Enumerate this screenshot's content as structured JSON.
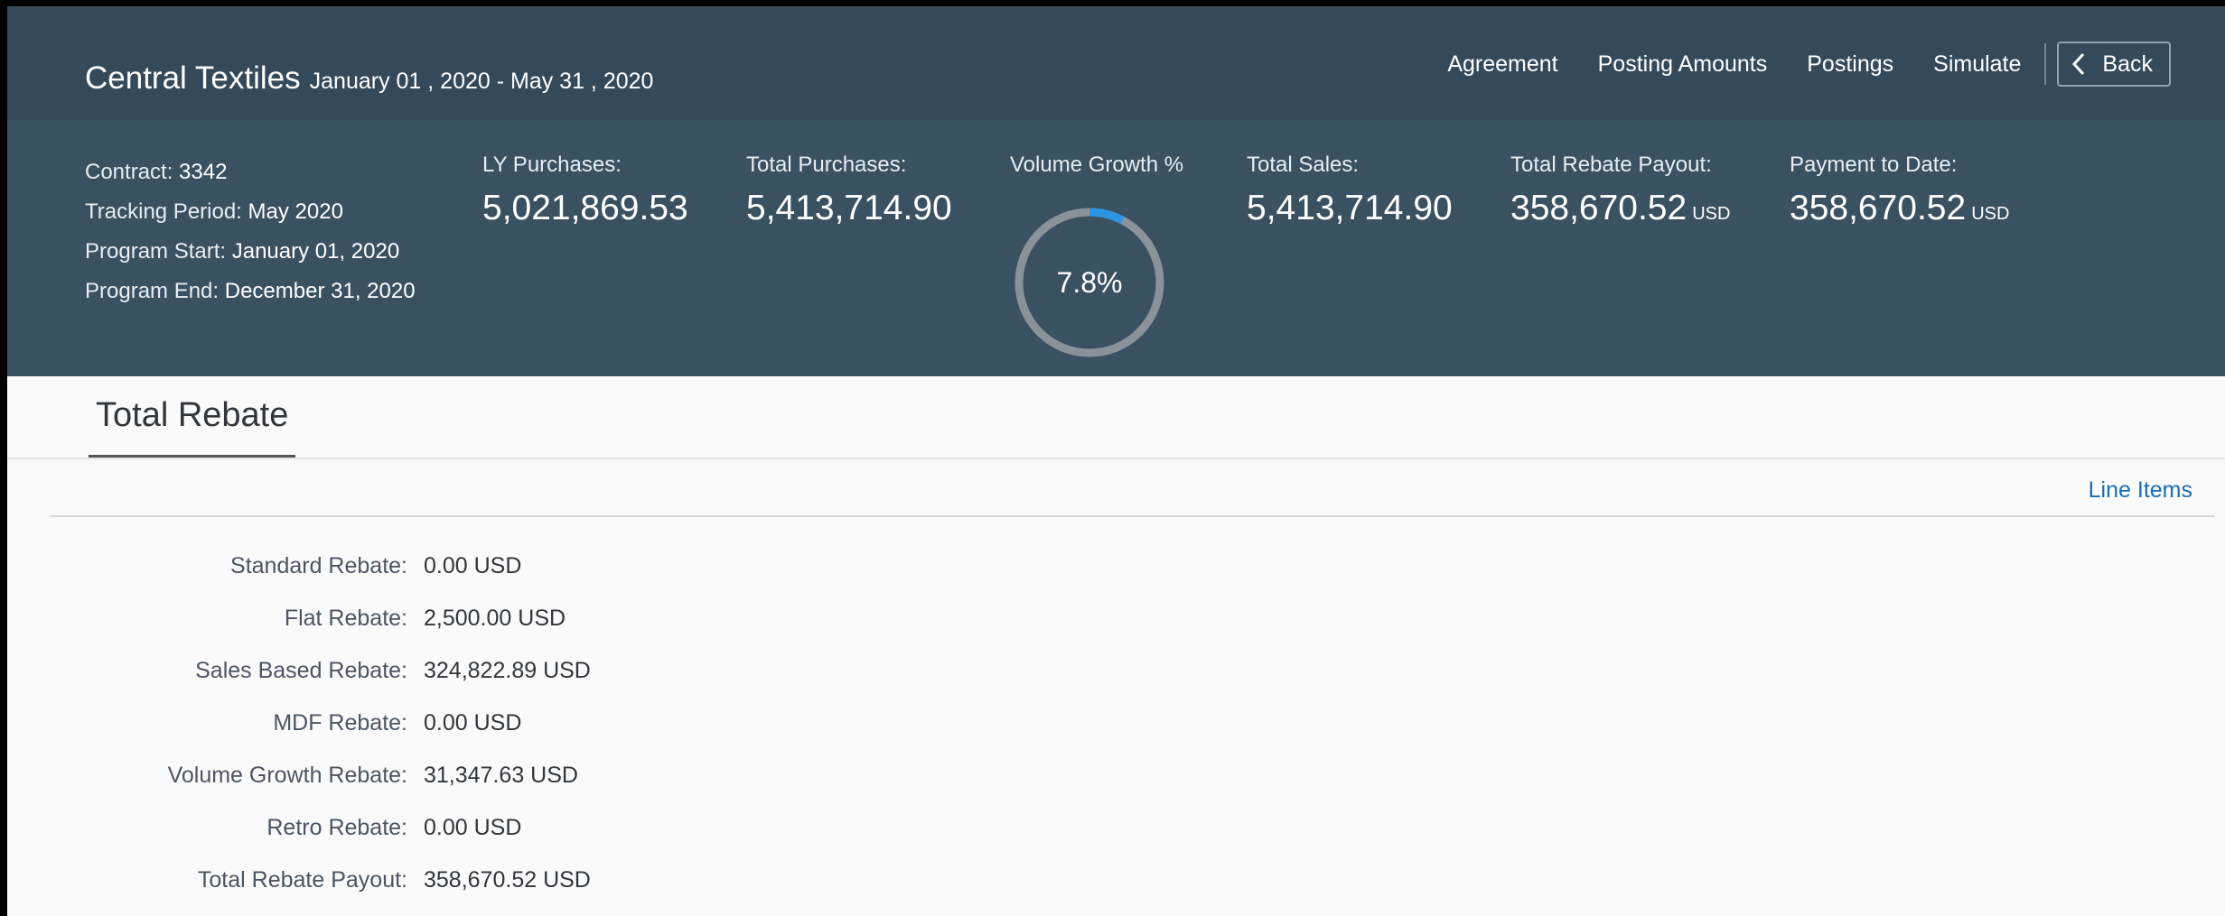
{
  "header": {
    "title": "Central Textiles",
    "period": "January 01 , 2020 - May 31 , 2020",
    "nav": [
      {
        "label": "Agreement"
      },
      {
        "label": "Posting Amounts"
      },
      {
        "label": "Postings"
      },
      {
        "label": "Simulate"
      }
    ],
    "back_label": "Back"
  },
  "contract": {
    "contract_label": "Contract:",
    "contract_value": "3342",
    "tracking_label": "Tracking Period:",
    "tracking_value": "May 2020",
    "start_label": "Program Start:",
    "start_value": "January 01, 2020",
    "end_label": "Program End:",
    "end_value": "December 31, 2020"
  },
  "kpis": {
    "ly_purchases": {
      "label": "LY Purchases:",
      "value": "5,021,869.53"
    },
    "total_purchases": {
      "label": "Total Purchases:",
      "value": "5,413,714.90"
    },
    "volume_growth": {
      "label": "Volume Growth %",
      "value": "7.8%",
      "fraction": 0.078
    },
    "total_sales": {
      "label": "Total Sales:",
      "value": "5,413,714.90"
    },
    "total_rebate_payout": {
      "label": "Total Rebate Payout:",
      "value": "358,670.52",
      "unit": "USD"
    },
    "payment_to_date": {
      "label": "Payment to Date:",
      "value": "358,670.52",
      "unit": "USD"
    }
  },
  "colors": {
    "header_bg": "#3a5162",
    "title_bar_bg": "#344a5a",
    "donut_track": "#8a9299",
    "donut_fill": "#2d95e0",
    "link": "#1a6db3"
  },
  "tabs": [
    {
      "label": "Total Rebate"
    }
  ],
  "line_items_label": "Line Items",
  "rebates": [
    {
      "label": "Standard Rebate:",
      "value": "0.00 USD"
    },
    {
      "label": "Flat Rebate:",
      "value": "2,500.00 USD"
    },
    {
      "label": "Sales Based Rebate:",
      "value": "324,822.89 USD"
    },
    {
      "label": "MDF Rebate:",
      "value": "0.00 USD"
    },
    {
      "label": "Volume Growth Rebate:",
      "value": "31,347.63 USD"
    },
    {
      "label": "Retro Rebate:",
      "value": "0.00 USD"
    },
    {
      "label": "Total Rebate Payout:",
      "value": "358,670.52 USD"
    }
  ]
}
